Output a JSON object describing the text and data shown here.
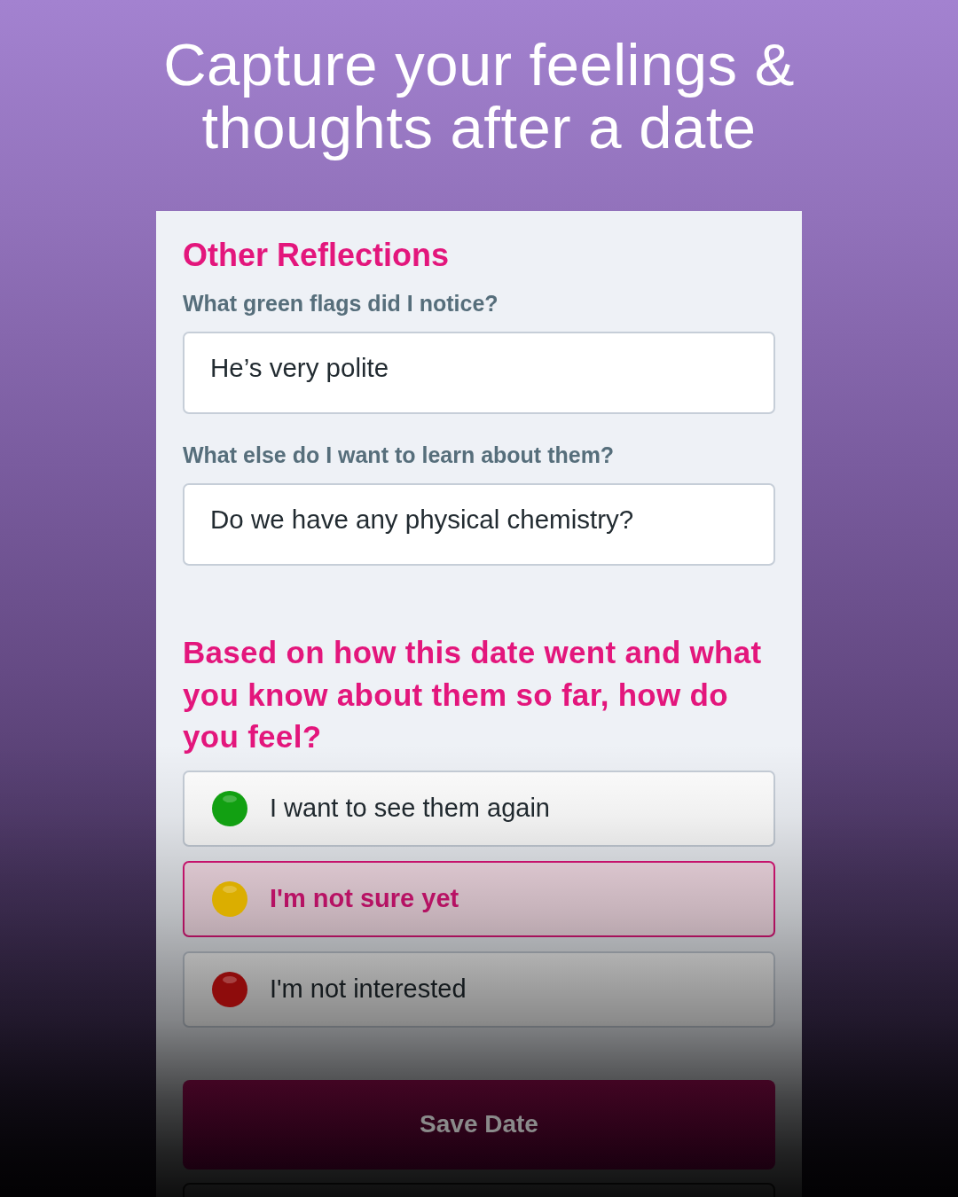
{
  "headline": "Capture your feelings & thoughts after a date",
  "form": {
    "section_title": "Other Reflections",
    "questions": [
      {
        "label": "What green flags did I notice?",
        "value": "He’s very polite"
      },
      {
        "label": "What else do I want to learn about them?",
        "value": "Do we have any physical chemistry?"
      }
    ],
    "feeling_prompt": "Based on how this date went and what you know about them so far, how do you feel?",
    "feeling_options": [
      {
        "label": "I want to see them again",
        "color": "#12a012",
        "selected": false
      },
      {
        "label": "I'm not sure yet",
        "color": "#dbae00",
        "selected": true
      },
      {
        "label": "I'm not interested",
        "color": "#8e0c0c",
        "selected": false
      }
    ],
    "save_button": "Save Date"
  }
}
